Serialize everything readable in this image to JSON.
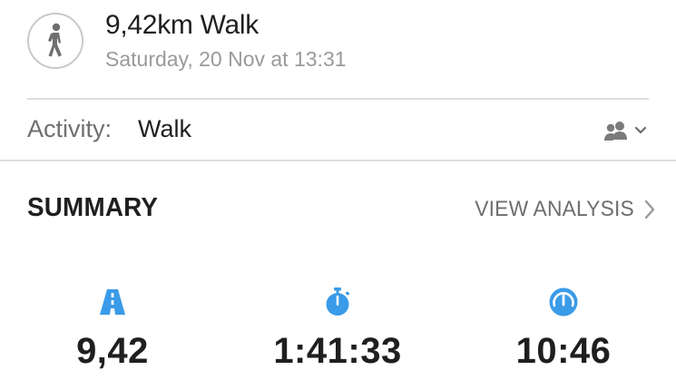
{
  "activity": {
    "title": "9,42km Walk",
    "datetime": "Saturday, 20 Nov at 13:31",
    "type_label": "Activity:",
    "type_value": "Walk",
    "icon": "walking-person-icon",
    "privacy_icon": "people-icon"
  },
  "summary": {
    "title": "SUMMARY",
    "view_analysis": "VIEW ANALYSIS"
  },
  "stats": [
    {
      "name": "distance",
      "icon": "road-icon",
      "value": "9,42"
    },
    {
      "name": "duration",
      "icon": "stopwatch-icon",
      "value": "1:41:33"
    },
    {
      "name": "pace",
      "icon": "speedometer-icon",
      "value": "10:46"
    }
  ],
  "colors": {
    "accent": "#3a9be8",
    "text": "#1f1f1f",
    "muted": "#9a9a9a",
    "divider": "#dedede"
  }
}
